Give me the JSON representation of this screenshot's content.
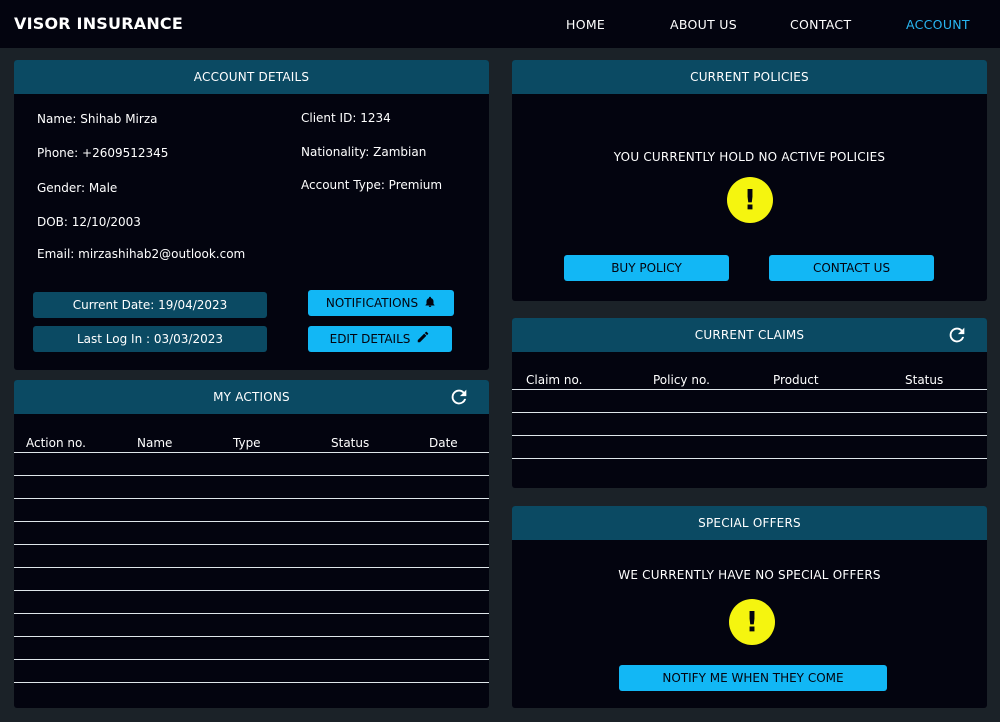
{
  "brand": "VISOR INSURANCE",
  "nav": {
    "home": "HOME",
    "about": "ABOUT US",
    "contact": "CONTACT",
    "account": "ACCOUNT"
  },
  "account_details": {
    "title": "ACCOUNT DETAILS",
    "name": "Name: Shihab Mirza",
    "phone": "Phone: +2609512345",
    "gender": "Gender: Male",
    "dob": "DOB: 12/10/2003",
    "email": "Email: mirzashihab2@outlook.com",
    "client_id": "Client ID: 1234",
    "nationality": "Nationality: Zambian",
    "account_type": "Account Type: Premium",
    "current_date": "Current Date: 19/04/2023",
    "last_login": "Last Log In : 03/03/2023",
    "notifications_label": "NOTIFICATIONS",
    "edit_label": "EDIT DETAILS"
  },
  "my_actions": {
    "title": "MY ACTIONS",
    "columns": [
      "Action no.",
      "Name",
      "Type",
      "Status",
      "Date"
    ]
  },
  "current_policies": {
    "title": "CURRENT POLICIES",
    "message": "YOU CURRENTLY HOLD NO ACTIVE POLICIES",
    "buy_label": "BUY POLICY",
    "contact_label": "CONTACT US"
  },
  "current_claims": {
    "title": "CURRENT CLAIMS",
    "columns": [
      "Claim no.",
      "Policy no.",
      "Product",
      "Status"
    ]
  },
  "special_offers": {
    "title": "SPECIAL OFFERS",
    "message": "WE CURRENTLY HAVE NO SPECIAL OFFERS",
    "notify_label": "NOTIFY ME WHEN THEY COME"
  },
  "icons": {
    "warning": "!",
    "refresh": "refresh-icon",
    "bell": "bell-icon",
    "pencil": "pencil-icon"
  },
  "colors": {
    "background": "#1b2228",
    "panel": "#03040f",
    "panel_header": "#0b4a63",
    "accent": "#12b7f5",
    "active_nav": "#29b6f2",
    "warning": "#f5f50f"
  }
}
